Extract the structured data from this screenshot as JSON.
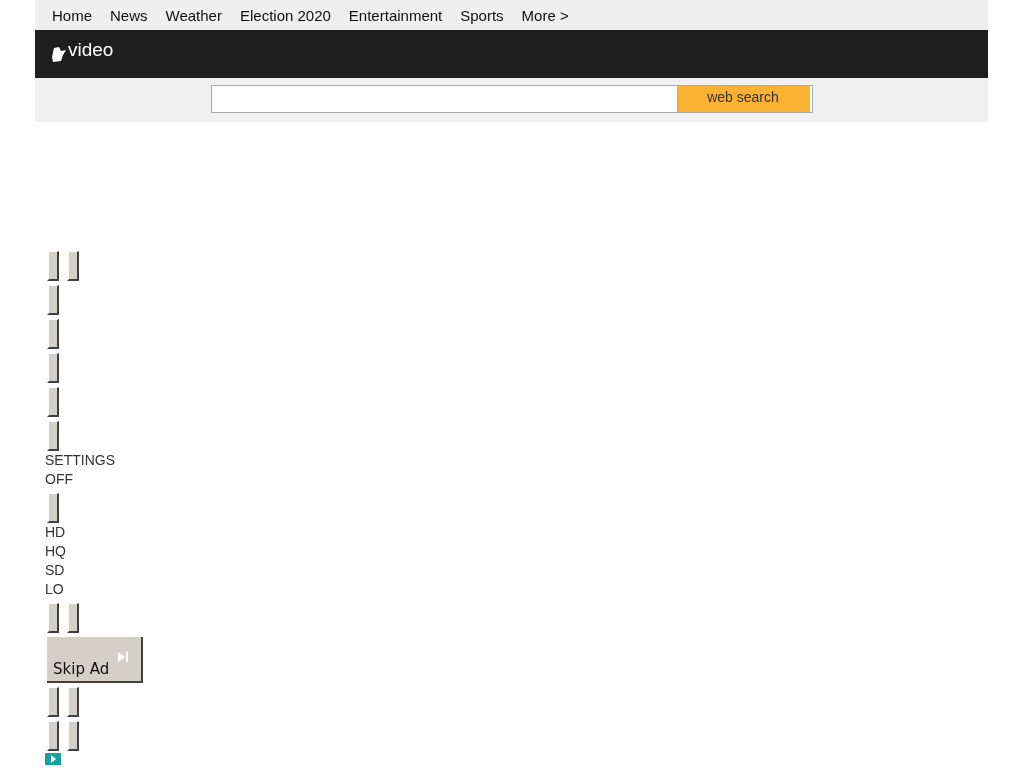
{
  "nav": [
    "Home",
    "News",
    "Weather",
    "Election 2020",
    "Entertainment",
    "Sports",
    "More >"
  ],
  "header": {
    "title": "video"
  },
  "search": {
    "button": "web search"
  },
  "player": [
    {
      "kind": "pair"
    },
    {
      "kind": "single"
    },
    {
      "kind": "single"
    },
    {
      "kind": "single"
    },
    {
      "kind": "single"
    },
    {
      "kind": "single"
    },
    {
      "kind": "text",
      "text": "SETTINGS"
    },
    {
      "kind": "text",
      "text": "OFF"
    },
    {
      "kind": "single"
    },
    {
      "kind": "text",
      "text": "HD"
    },
    {
      "kind": "text",
      "text": "HQ"
    },
    {
      "kind": "text",
      "text": "SD"
    },
    {
      "kind": "text",
      "text": "LO"
    },
    {
      "kind": "pair"
    },
    {
      "kind": "skip",
      "text": "Skip Ad"
    },
    {
      "kind": "pair"
    },
    {
      "kind": "pair"
    },
    {
      "kind": "play"
    }
  ]
}
